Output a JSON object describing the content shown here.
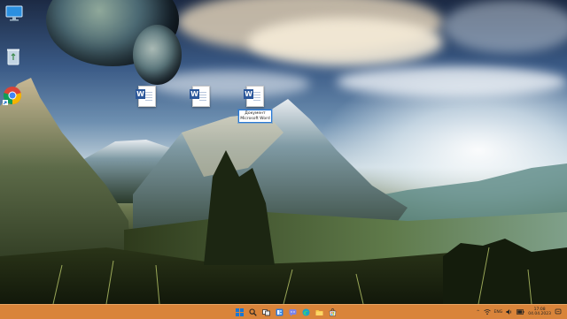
{
  "desktop": {
    "system_icons": [
      {
        "name": "this-pc-icon"
      },
      {
        "name": "recycle-bin-icon"
      },
      {
        "name": "chrome-icon"
      }
    ],
    "documents": [
      {
        "name": "word-document-1"
      },
      {
        "name": "word-document-2"
      },
      {
        "name": "word-document-3",
        "rename_text": "Документ Microsoft Word"
      }
    ]
  },
  "taskbar": {
    "color": "#d9843a",
    "apps": [
      {
        "name": "start-button",
        "icon": "windows-logo-icon"
      },
      {
        "name": "search-button",
        "icon": "search-icon"
      },
      {
        "name": "task-view-button",
        "icon": "task-view-icon"
      },
      {
        "name": "widgets-button",
        "icon": "widgets-icon"
      },
      {
        "name": "chat-button",
        "icon": "chat-icon"
      },
      {
        "name": "edge-button",
        "icon": "edge-icon"
      },
      {
        "name": "file-explorer-button",
        "icon": "folder-icon"
      },
      {
        "name": "store-button",
        "icon": "store-icon"
      }
    ],
    "tray": {
      "chevron": "^",
      "language": "ENG",
      "time": "17:08",
      "date": "04.04.2023"
    }
  }
}
